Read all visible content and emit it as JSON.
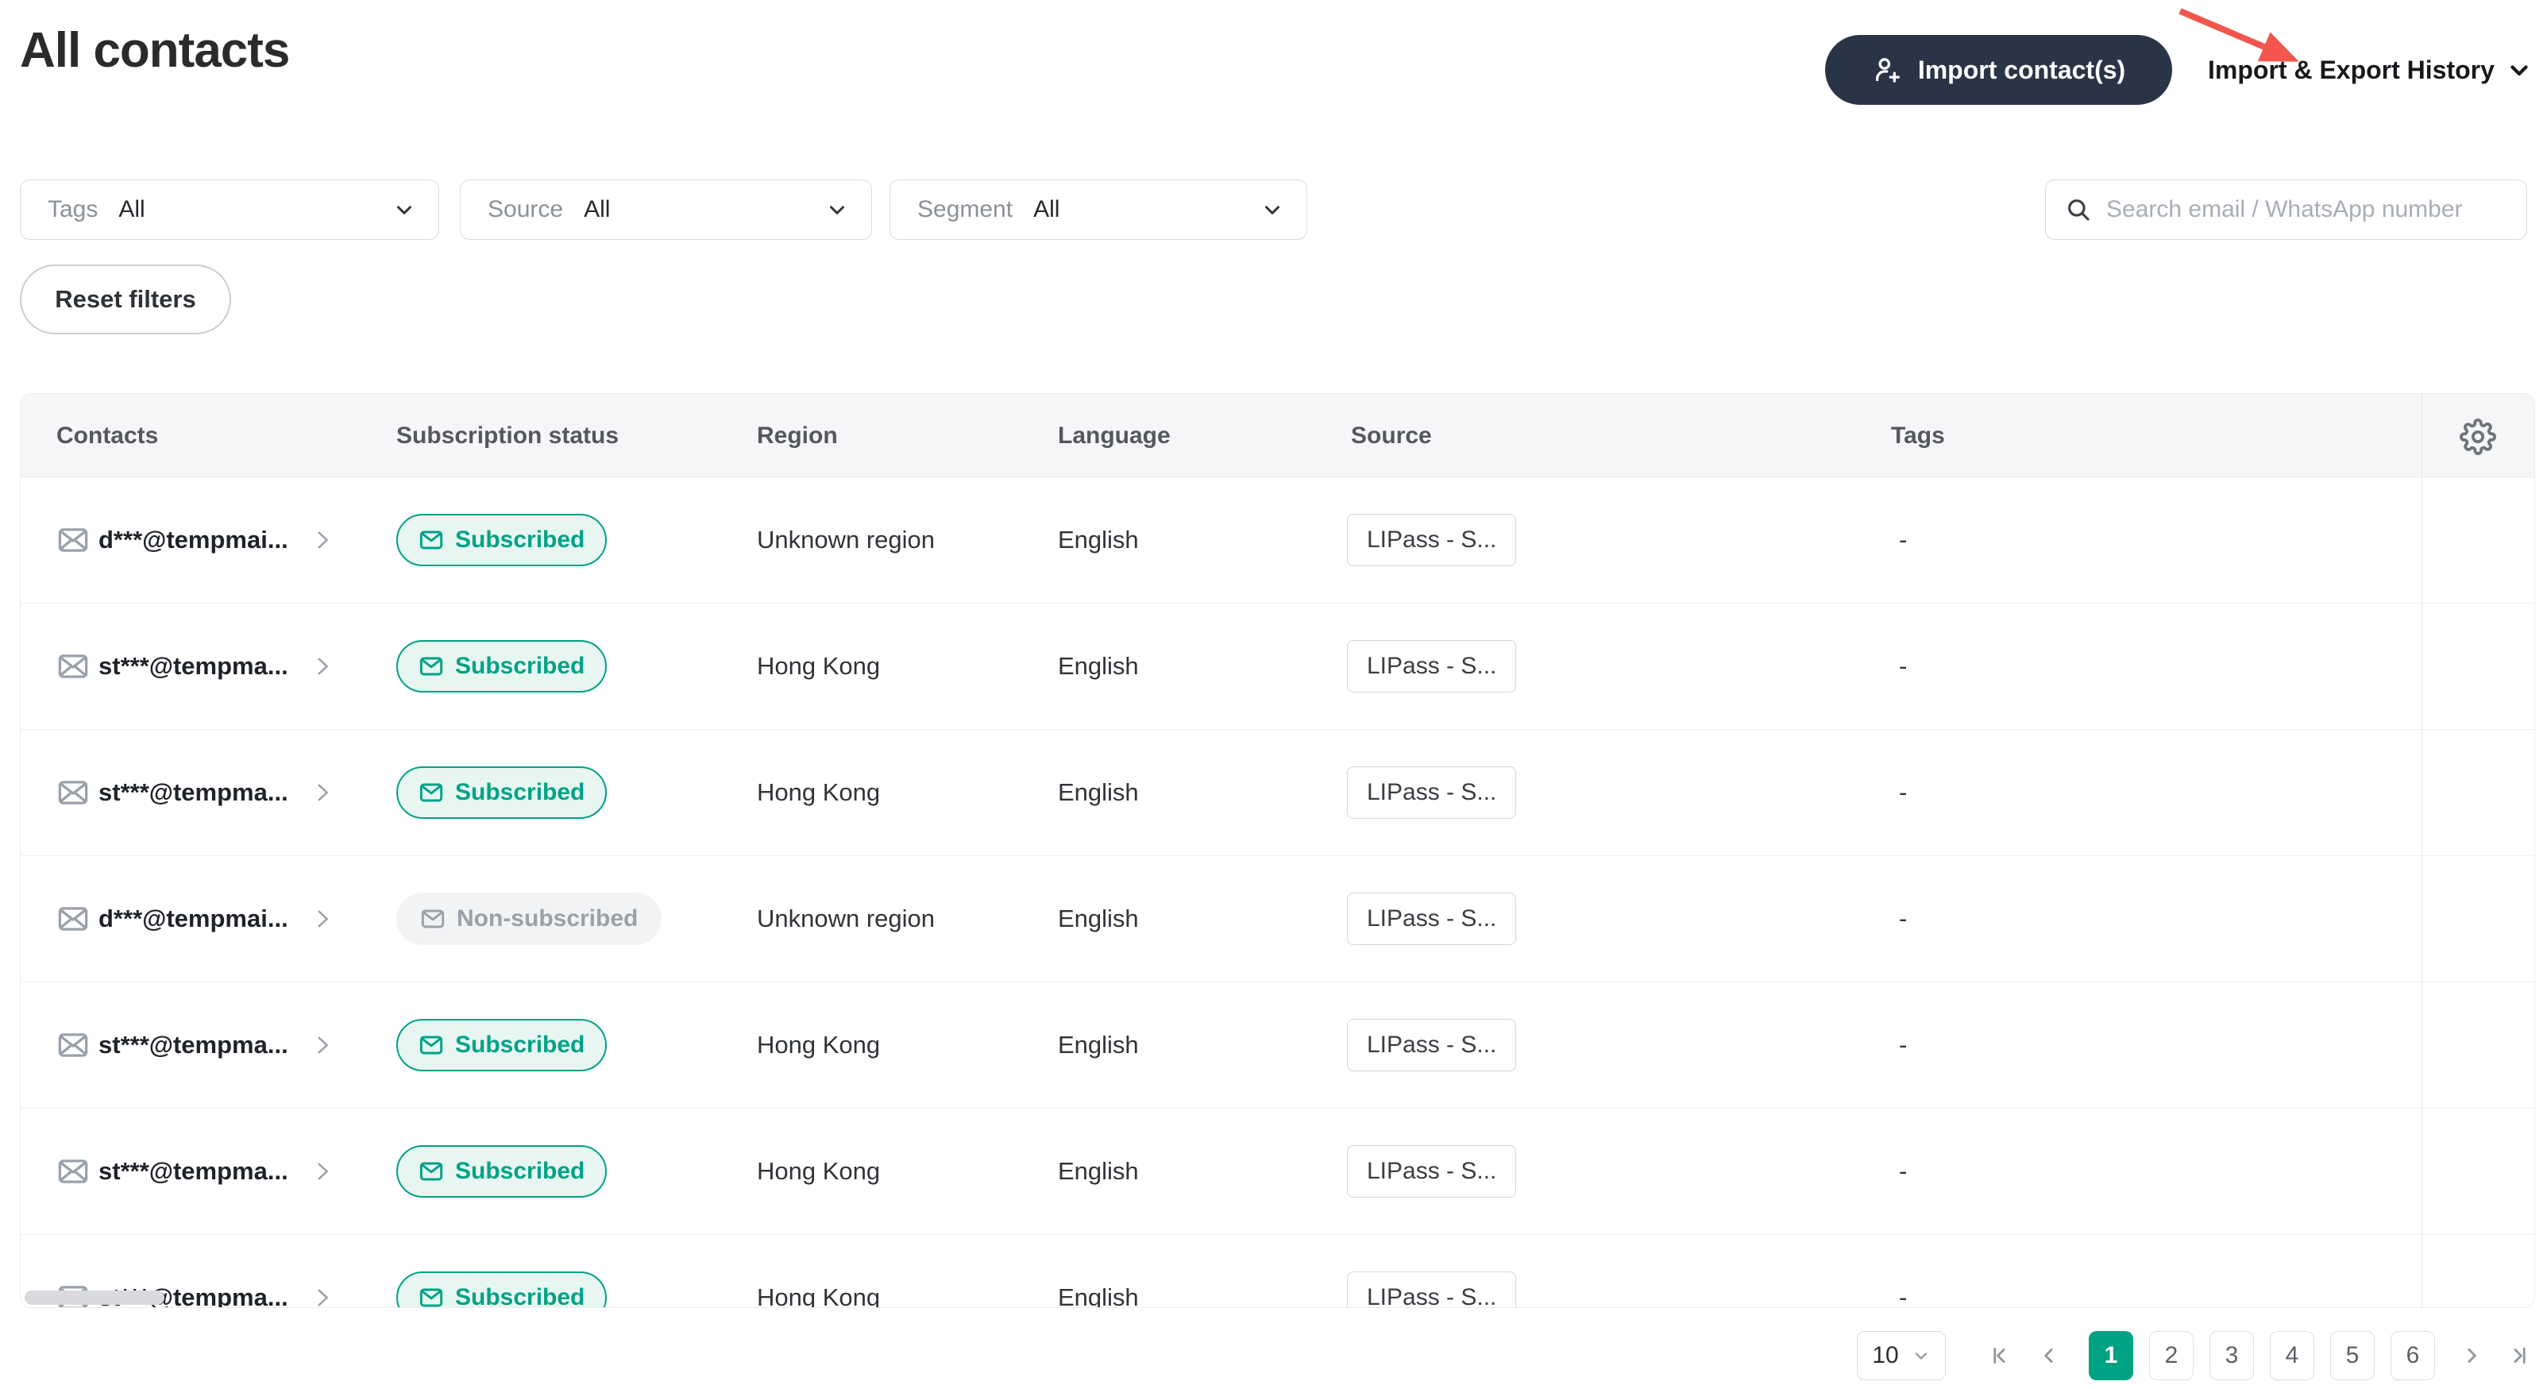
{
  "page": {
    "title": "All contacts"
  },
  "toolbar": {
    "import_button_label": "Import contact(s)",
    "history_label": "Import & Export History"
  },
  "filters": {
    "tags_label": "Tags",
    "tags_value": "All",
    "source_label": "Source",
    "source_value": "All",
    "segment_label": "Segment",
    "segment_value": "All",
    "search_placeholder": "Search email / WhatsApp number",
    "reset_label": "Reset filters"
  },
  "table": {
    "headers": {
      "contacts": "Contacts",
      "status": "Subscription status",
      "region": "Region",
      "language": "Language",
      "source": "Source",
      "tags": "Tags"
    },
    "rows": [
      {
        "contact": "d***@tempmai...",
        "status": "Subscribed",
        "subscribed": true,
        "region": "Unknown region",
        "language": "English",
        "source": "LIPass - S...",
        "tags": "-"
      },
      {
        "contact": "st***@tempma...",
        "status": "Subscribed",
        "subscribed": true,
        "region": "Hong Kong",
        "language": "English",
        "source": "LIPass - S...",
        "tags": "-"
      },
      {
        "contact": "st***@tempma...",
        "status": "Subscribed",
        "subscribed": true,
        "region": "Hong Kong",
        "language": "English",
        "source": "LIPass - S...",
        "tags": "-"
      },
      {
        "contact": "d***@tempmai...",
        "status": "Non-subscribed",
        "subscribed": false,
        "region": "Unknown region",
        "language": "English",
        "source": "LIPass - S...",
        "tags": "-"
      },
      {
        "contact": "st***@tempma...",
        "status": "Subscribed",
        "subscribed": true,
        "region": "Hong Kong",
        "language": "English",
        "source": "LIPass - S...",
        "tags": "-"
      },
      {
        "contact": "st***@tempma...",
        "status": "Subscribed",
        "subscribed": true,
        "region": "Hong Kong",
        "language": "English",
        "source": "LIPass - S...",
        "tags": "-"
      },
      {
        "contact": "st***@tempma...",
        "status": "Subscribed",
        "subscribed": true,
        "region": "Hong Kong",
        "language": "English",
        "source": "LIPass - S...",
        "tags": "-"
      }
    ]
  },
  "pagination": {
    "page_size": "10",
    "pages": [
      "1",
      "2",
      "3",
      "4",
      "5",
      "6"
    ],
    "active_page": "1"
  },
  "icons": {
    "person-add-icon": "person silhouette with plus sign",
    "chevron-down-icon": "v chevron",
    "search-icon": "magnifier",
    "mail-icon": "outlined envelope",
    "chevron-right-icon": "> chevron",
    "gear-icon": "cog outline",
    "first-page-icon": "bar + left chevron",
    "prev-page-icon": "left chevron",
    "next-page-icon": "right chevron",
    "last-page-icon": "right chevron + bar",
    "red-arrow-annotation": "diagonal red arrow pointing to Import & Export History"
  },
  "colors": {
    "accent_teal": "#00a286",
    "dark_navy": "#2a3447",
    "annotation_red": "#f2564d",
    "subscribed_bg": "#e7f6f1",
    "non_subscribed_gray": "#9ba1a8",
    "header_bg": "#f6f6f8"
  }
}
